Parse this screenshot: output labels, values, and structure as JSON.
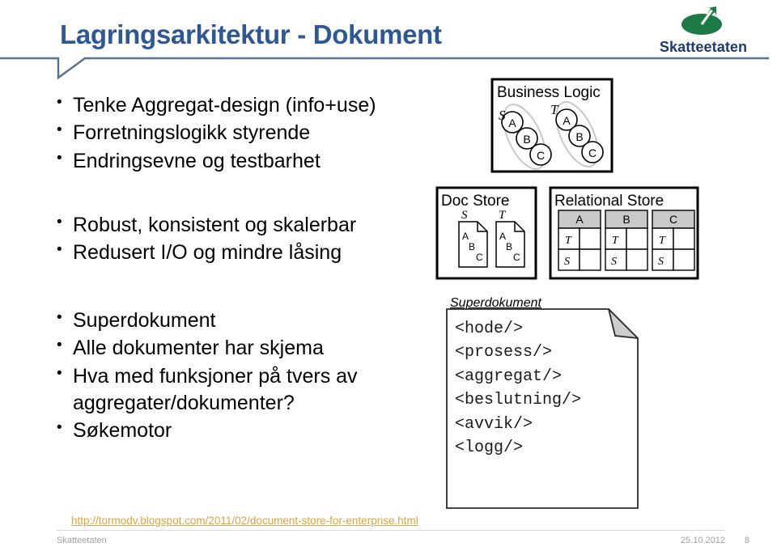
{
  "slide": {
    "title": "Lagringsarkitektur - Dokument"
  },
  "logo": {
    "mark": "skatteetaten-logo-icon",
    "text": "Skatteetaten",
    "mark_color": "#1B7A45",
    "text_color": "#1F3A6E"
  },
  "theme": {
    "title_color": "#2E5795",
    "rule_color": "#5A6E92",
    "link_color": "#D9A441",
    "footer_color": "#A0A0A0"
  },
  "bullets_group_1": [
    "Tenke Aggregat-design (info+use)",
    "Forretningslogikk styrende",
    "Endringsevne og testbarhet"
  ],
  "bullets_group_2": [
    "Robust, konsistent og skalerbar",
    "Redusert I/O og mindre låsing"
  ],
  "bullets_group_3": [
    "Superdokument",
    "Alle dokumenter har skjema",
    "Hva med funksjoner på tvers av aggregater/dokumenter?",
    "Søkemotor"
  ],
  "bullet_marker": "•",
  "diagram": {
    "business_logic": {
      "title": "Business Logic",
      "aggregates": [
        {
          "label": "S",
          "nodes": [
            "A",
            "B",
            "C"
          ]
        },
        {
          "label": "T",
          "nodes": [
            "A",
            "B",
            "C"
          ]
        }
      ]
    },
    "doc_store": {
      "title": "Doc Store",
      "documents": [
        {
          "label": "S",
          "items": [
            "A",
            "B",
            "C"
          ]
        },
        {
          "label": "T",
          "items": [
            "A",
            "B",
            "C"
          ]
        }
      ]
    },
    "relational_store": {
      "title": "Relational Store",
      "tables": [
        {
          "header": "A",
          "rows": [
            "T",
            "S"
          ]
        },
        {
          "header": "B",
          "rows": [
            "T",
            "S"
          ]
        },
        {
          "header": "C",
          "rows": [
            "T",
            "S"
          ]
        }
      ],
      "header_fill": "#C9C9C9"
    }
  },
  "superdocument": {
    "label": "Superdokument",
    "lines": [
      "<hode/>",
      "<prosess/>",
      "<aggregat/>",
      "<beslutning/>",
      "<avvik/>",
      "<logg/>"
    ],
    "fold_fill": "#CCCCCC"
  },
  "source_link": "http://tormodv.blogspot.com/2011/02/document-store-for-enterprise.html",
  "footer": {
    "left": "Skatteetaten",
    "date": "25.10.2012",
    "page": "8"
  }
}
